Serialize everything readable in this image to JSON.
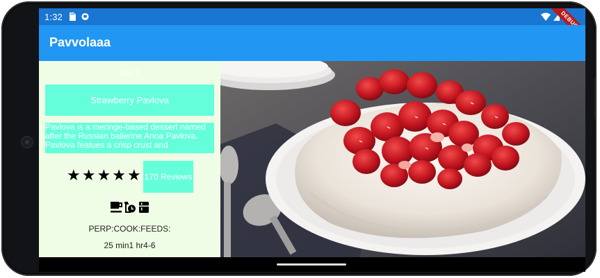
{
  "status_bar": {
    "time": "1:32",
    "debug_label": "DEBUG"
  },
  "app_bar": {
    "title": "Pavvolaaa"
  },
  "left_panel": {
    "box_label": "Box 1",
    "recipe_title": "Strawberry Pavlova",
    "description": "Pavlova is a meringe-based dessert named after the Russian ballerine Anna Pavlova. Pavlova featues a crisp crust and",
    "stars": [
      "★",
      "★",
      "★",
      "★",
      "★"
    ],
    "reviews": "170 Reviews",
    "icons": [
      "coffee-cup-icon",
      "timer-clock-icon",
      "kitchen-icon"
    ],
    "info_labels": "PERP:COOK:FEEDS:",
    "info_values": "25 min1 hr4-6"
  },
  "photo": {
    "subject": "strawberry-pavlova-photo"
  },
  "colors": {
    "status_bar": "#1976d2",
    "app_bar": "#2196f3",
    "panel_bg": "#f0fde6",
    "accent_box": "#64ffda"
  }
}
